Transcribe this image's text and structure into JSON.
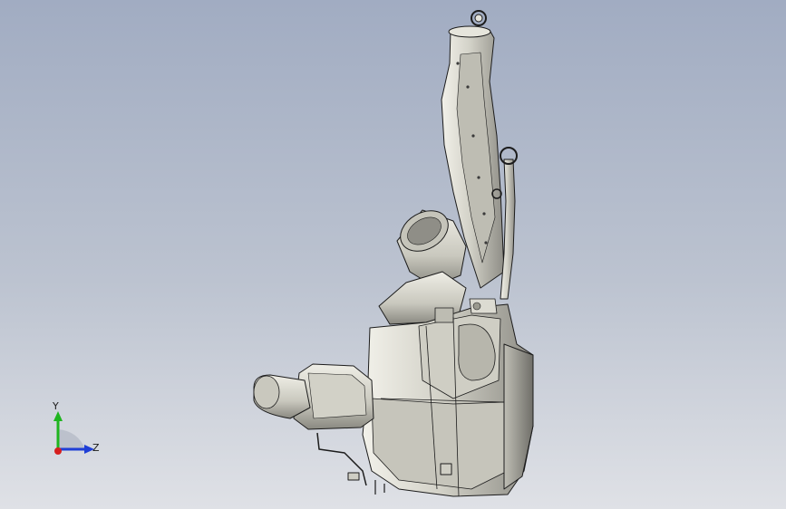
{
  "viewport": {
    "background_top": "#a1acc2",
    "background_bottom": "#dfe1e6"
  },
  "model": {
    "fill_color": "#d9d8cf",
    "shade_color": "#9e9d95",
    "edge_color": "#1c1c1c"
  },
  "triad": {
    "y_label": "Y",
    "z_label": "Z",
    "y_color": "#1fb51f",
    "z_color": "#1f3fd6",
    "x_color": "#d61f1f"
  }
}
